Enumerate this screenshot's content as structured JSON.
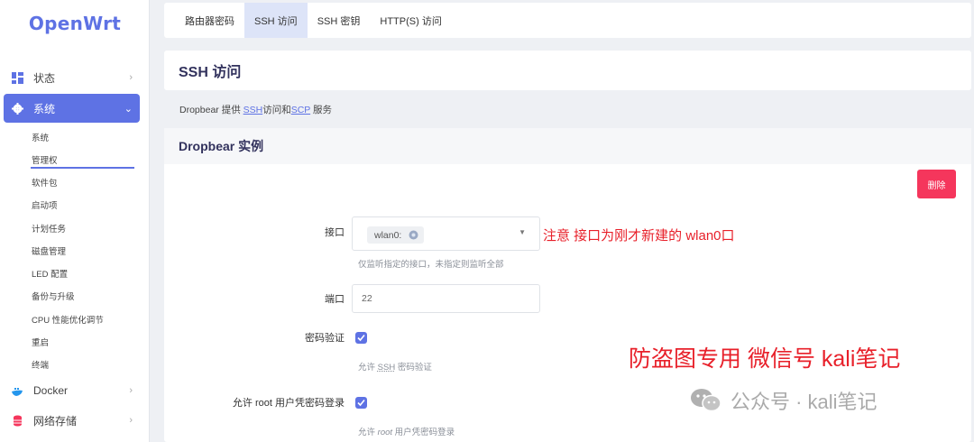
{
  "brand": {
    "logo": "OpenWrt",
    "accent": "#5e72e4",
    "danger": "#f5365c"
  },
  "sidebar": {
    "items": [
      {
        "label": "状态",
        "icon": "dashboard-icon"
      },
      {
        "label": "系统",
        "icon": "gear-icon"
      },
      {
        "label": "Docker",
        "icon": "docker-whale-icon"
      },
      {
        "label": "网络存储",
        "icon": "storage-icon"
      }
    ],
    "sub_items": [
      "系统",
      "管理权",
      "软件包",
      "启动项",
      "计划任务",
      "磁盘管理",
      "LED 配置",
      "备份与升级",
      "CPU 性能优化调节",
      "重启",
      "终端"
    ]
  },
  "tabs": [
    "路由器密码",
    "SSH 访问",
    "SSH 密钥",
    "HTTP(S) 访问"
  ],
  "page": {
    "title": "SSH 访问",
    "desc_prefix": "Dropbear 提供",
    "desc_link1": "SSH",
    "desc_mid": "访问和",
    "desc_link2": "SCP",
    "desc_suffix": "服务"
  },
  "instance": {
    "title": "Dropbear 实例",
    "delete_label": "删除",
    "interface_label": "接口",
    "interface_value": "wlan0:",
    "interface_hint": "仅监听指定的接口，未指定则监听全部",
    "port_label": "端口",
    "port_value": "22",
    "password_auth_label": "密码验证",
    "password_auth_hint_pre": "允许",
    "password_auth_hint_abbr": "SSH",
    "password_auth_hint_post": "密码验证",
    "root_login_label": "允许 root 用户凭密码登录",
    "root_login_hint_pre": "允许",
    "root_login_hint_em": "root",
    "root_login_hint_post": "用户凭密码登录"
  },
  "annotations": {
    "note": "注意 接口为刚才新建的 wlan0口",
    "watermark_red": "防盗图专用  微信号 kali笔记",
    "watermark_gray": "公众号 · kali笔记"
  }
}
